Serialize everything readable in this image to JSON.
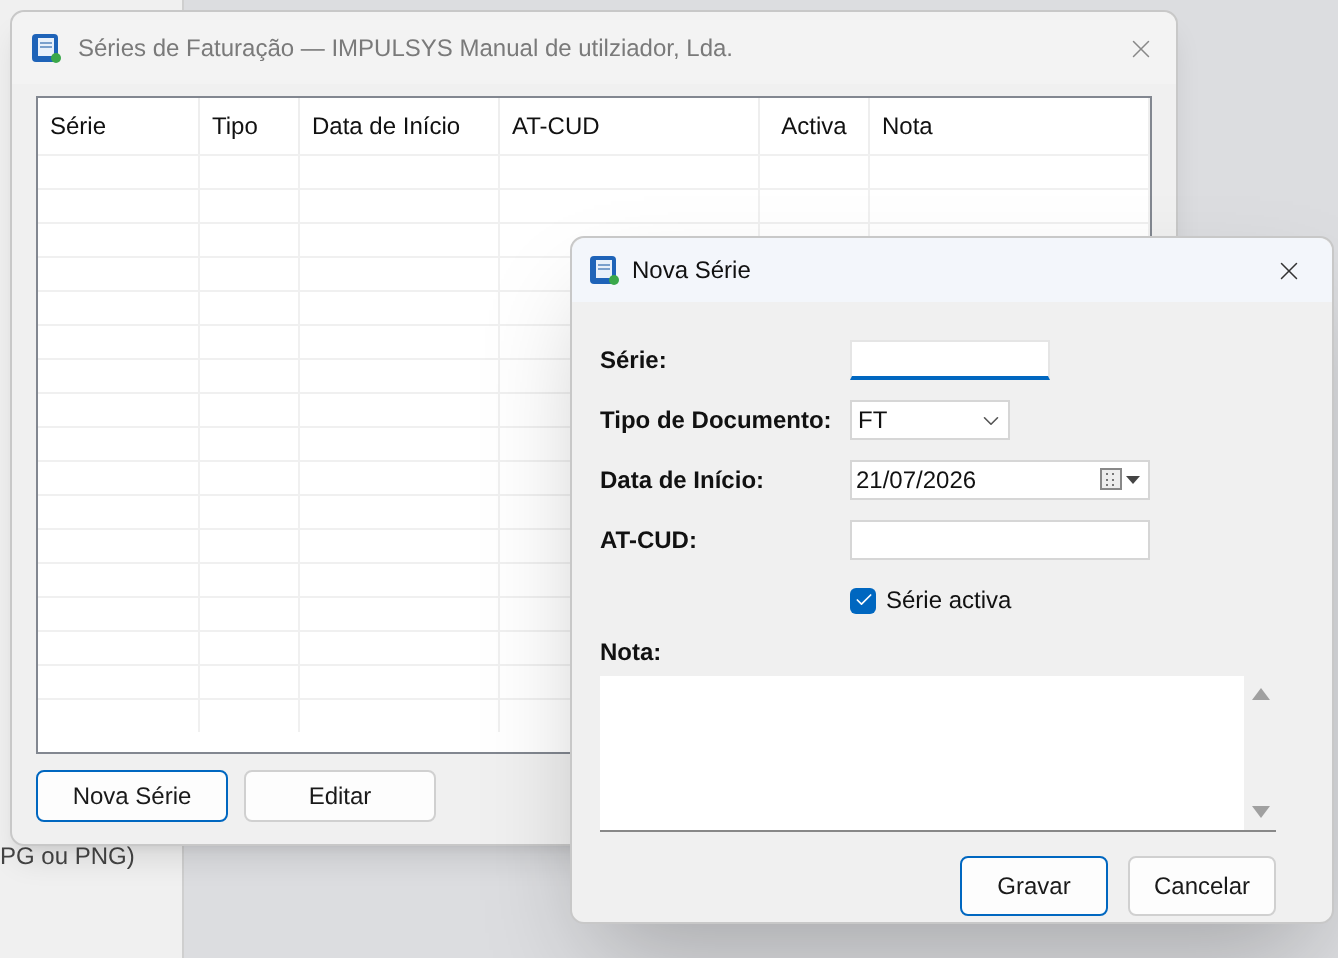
{
  "background": {
    "text": "PG ou PNG)"
  },
  "main_window": {
    "title": "Séries de Faturação — IMPULSYS Manual de utilziador, Lda.",
    "table": {
      "columns": [
        "Série",
        "Tipo",
        "Data de Início",
        "AT-CUD",
        "Activa",
        "Nota"
      ]
    },
    "buttons": [
      {
        "label": "Nova Série",
        "focused": true
      },
      {
        "label": "Editar",
        "focused": false
      }
    ]
  },
  "dialog": {
    "title": "Nova Série",
    "fields": [
      {
        "kind": "text",
        "label": "Série:",
        "focused": true
      },
      {
        "kind": "select",
        "label": "Tipo de Documento:",
        "value": "FT",
        "focused": false
      },
      {
        "kind": "date",
        "label": "Data de Início:",
        "value": "21/07/2026",
        "focused": false
      },
      {
        "kind": "text",
        "label": "AT-CUD:",
        "focused": false
      }
    ],
    "checkbox": {
      "label": "Série activa",
      "checked": true
    },
    "note": {
      "label": "Nota:"
    },
    "buttons": [
      {
        "label": "Gravar",
        "focused": true
      },
      {
        "label": "Cancelar",
        "focused": false
      }
    ]
  }
}
